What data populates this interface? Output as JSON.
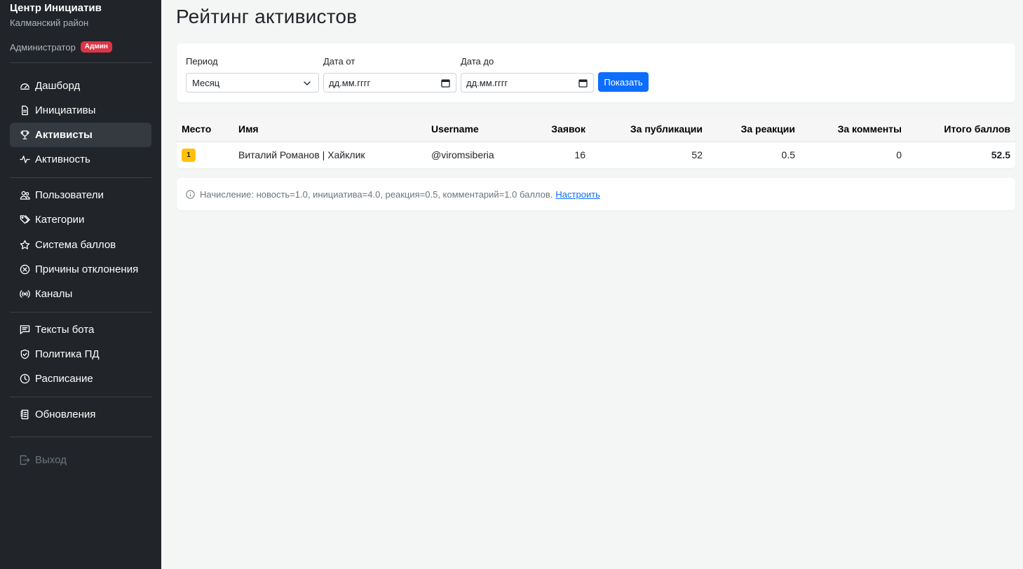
{
  "sidebar": {
    "brand": "Центр Инициатив",
    "district": "Калманский район",
    "role": "Администратор",
    "role_badge": "Админ",
    "items": [
      {
        "label": "Дашборд",
        "icon": "dashboard-icon"
      },
      {
        "label": "Инициативы",
        "icon": "document-icon"
      },
      {
        "label": "Активисты",
        "icon": "trophy-icon",
        "active": true
      },
      {
        "label": "Активность",
        "icon": "activity-icon"
      },
      {
        "label": "Пользователи",
        "icon": "users-icon"
      },
      {
        "label": "Категории",
        "icon": "tags-icon"
      },
      {
        "label": "Система баллов",
        "icon": "star-icon"
      },
      {
        "label": "Причины отклонения",
        "icon": "x-circle-icon"
      },
      {
        "label": "Каналы",
        "icon": "broadcast-icon"
      },
      {
        "label": "Тексты бота",
        "icon": "chat-icon"
      },
      {
        "label": "Политика ПД",
        "icon": "shield-icon"
      },
      {
        "label": "Расписание",
        "icon": "clock-icon"
      },
      {
        "label": "Обновления",
        "icon": "journal-icon"
      },
      {
        "label": "Выход",
        "icon": "logout-icon"
      }
    ]
  },
  "page": {
    "title": "Рейтинг активистов"
  },
  "filters": {
    "period_label": "Период",
    "period_value": "Месяц",
    "date_from_label": "Дата от",
    "date_from_placeholder": "дд.мм.гггг",
    "date_to_label": "Дата до",
    "date_to_placeholder": "дд.мм.гггг",
    "show_button": "Показать"
  },
  "table": {
    "headers": {
      "place": "Место",
      "name": "Имя",
      "username": "Username",
      "requests": "Заявок",
      "publications": "За публикации",
      "reactions": "За реакции",
      "comments": "За комменты",
      "total": "Итого баллов"
    },
    "rows": [
      {
        "place": "1",
        "name": "Виталий Романов | Хайклик",
        "username": "@viromsiberia",
        "requests": "16",
        "publications": "52",
        "reactions": "0.5",
        "comments": "0",
        "total": "52.5"
      }
    ]
  },
  "note": {
    "text": "Начисление: новость=1.0, инициатива=4.0, реакция=0.5, комментарий=1.0 баллов.",
    "link": "Настроить"
  },
  "colors": {
    "sidebar_bg": "#212529",
    "accent": "#0d6efd",
    "badge": "#dc3545",
    "rank": "#ffc107"
  }
}
